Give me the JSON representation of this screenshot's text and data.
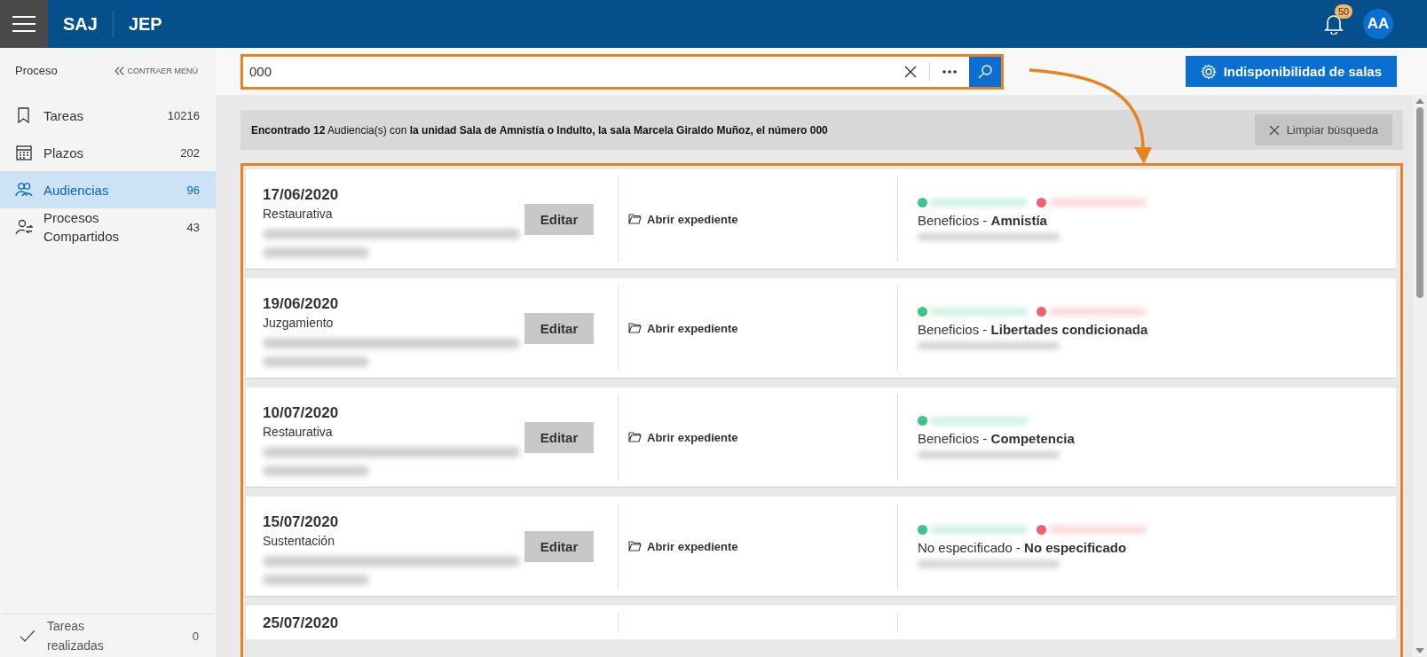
{
  "header": {
    "brand": "SAJ",
    "module": "JEP",
    "notifications": "50",
    "avatar": "AA"
  },
  "sidebar": {
    "title": "Proceso",
    "collapse": "CONTRAER MENÚ",
    "items": [
      {
        "label": "Tareas",
        "count": "10216",
        "selected": false
      },
      {
        "label": "Plazos",
        "count": "202",
        "selected": false
      },
      {
        "label": "Audiencias",
        "count": "96",
        "selected": true
      },
      {
        "label": "Procesos Compartidos",
        "count": "43",
        "selected": false
      }
    ],
    "footer": {
      "label": "Tareas realizadas",
      "count": "0"
    }
  },
  "search": {
    "value": "000"
  },
  "rooms_button": "Indisponibilidad de salas",
  "summary": {
    "text": "**Encontrado 12** Audiencia(s) con **la unidad Sala de Amnistía o Indulto, la sala Marcela Giraldo Muñoz, el número 000**",
    "clear_button": "Limpiar búsqueda"
  },
  "hearings": [
    {
      "date": "17/06/2020",
      "type": "Restaurativa",
      "edit_button": "Editar",
      "open_link": "Abrir expediente",
      "parties": [
        {
          "color": "#3dc48a"
        },
        {
          "color": "#f2606a"
        }
      ],
      "subject": "Beneficios - **Amnistía**"
    },
    {
      "date": "19/06/2020",
      "type": "Juzgamiento",
      "edit_button": "Editar",
      "open_link": "Abrir expediente",
      "parties": [
        {
          "color": "#3dc48a"
        },
        {
          "color": "#f2606a"
        }
      ],
      "subject": "Beneficios - **Libertades condicionada**"
    },
    {
      "date": "10/07/2020",
      "type": "Restaurativa",
      "edit_button": "Editar",
      "open_link": "Abrir expediente",
      "parties": [
        {
          "color": "#3dc48a"
        }
      ],
      "subject": "Beneficios - **Competencia**"
    },
    {
      "date": "15/07/2020",
      "type": "Sustentación",
      "edit_button": "Editar",
      "open_link": "Abrir expediente",
      "parties": [
        {
          "color": "#3dc48a"
        },
        {
          "color": "#f2606a"
        }
      ],
      "subject": "No especificado - **No especificado**"
    },
    {
      "date": "25/07/2020"
    }
  ]
}
